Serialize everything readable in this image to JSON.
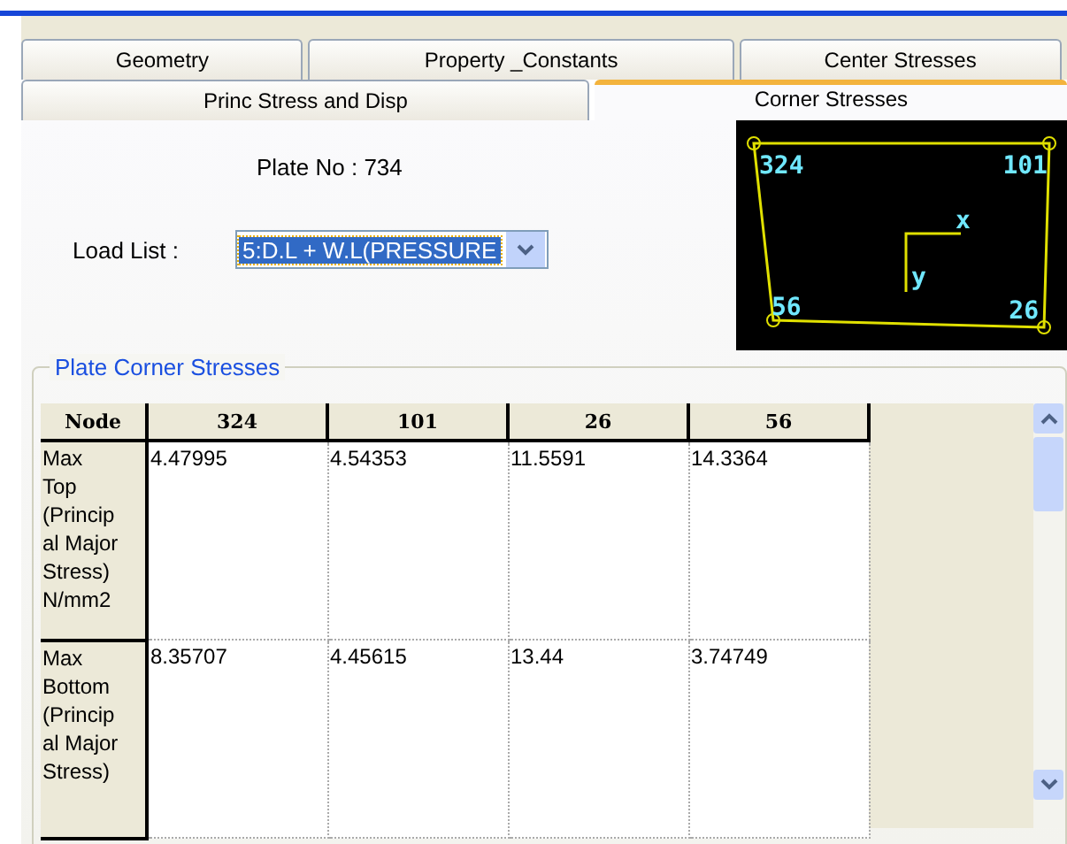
{
  "tabs_row_1": [
    {
      "label": "Geometry",
      "selected": false
    },
    {
      "label": "Property _Constants",
      "selected": false
    },
    {
      "label": "Center Stresses",
      "selected": false
    }
  ],
  "tabs_row_2": [
    {
      "label": "Princ Stress and Disp",
      "selected": false
    },
    {
      "label": "Corner Stresses",
      "selected": true
    }
  ],
  "plate_no": "Plate No : 734",
  "load_list": {
    "label": "Load List :",
    "value": "5:D.L + W.L(PRESSURE"
  },
  "diagram": {
    "corner_labels": [
      "324",
      "101",
      "56",
      "26"
    ],
    "axis_labels": [
      "x",
      "y"
    ]
  },
  "corner_stresses": {
    "title": "Plate Corner Stresses",
    "columns": [
      "Node",
      "324",
      "101",
      "26",
      "56"
    ],
    "rows": [
      {
        "cells": [
          "Max\nTop\n(Princip\nal Major\nStress)\nN/mm2",
          "4.47995",
          "4.54353",
          "11.5591",
          "14.3364"
        ]
      },
      {
        "cells": [
          "Max\nBottom\n(Princip\nal Major\nStress)",
          "8.35707",
          "4.45615",
          "13.44",
          "3.74749"
        ]
      }
    ]
  }
}
